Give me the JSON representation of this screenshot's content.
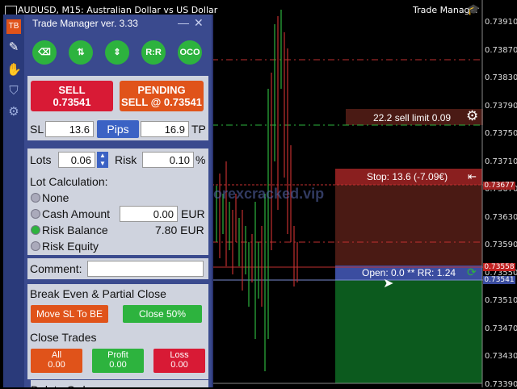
{
  "chart": {
    "symbol_title": "AUDUSD, M15:  Australian Dollar vs US Dollar",
    "trade_manager_label": "Trade Manager",
    "price_axis": [
      "0.73910",
      "0.73870",
      "0.73830",
      "0.73790",
      "0.73750",
      "0.73710",
      "0.73670",
      "0.73630",
      "0.73590",
      "0.73550",
      "0.73510",
      "0.73470",
      "0.73430",
      "0.73390"
    ],
    "sell_limit_label": "22.2 sell limit 0.09",
    "stop_label": "Stop: 13.6 (-7.09€)",
    "open_label": "Open: 0.0 ** RR: 1.24",
    "stop_price_tag": "0.73677",
    "bid_price_tag": "0.73558",
    "open_price_tag": "0.73541",
    "watermark": "forexcracked.vip"
  },
  "panel": {
    "title": "Trade Manager ver. 3.33",
    "toolbar": {
      "rr": "R:R",
      "oco": "OCO"
    },
    "sell_label": "SELL",
    "sell_price": "0.73541",
    "pending_label": "PENDING",
    "pending_price": "SELL @ 0.73541",
    "sl_label": "SL",
    "sl_value": "13.6",
    "pips_label": "Pips",
    "tp_value": "16.9",
    "tp_label": "TP",
    "lots_label": "Lots",
    "lots_value": "0.06",
    "risk_label": "Risk",
    "risk_value": "0.10",
    "percent": "%",
    "lot_calc_label": "Lot Calculation:",
    "none_label": "None",
    "cash_label": "Cash Amount",
    "cash_value": "0.00",
    "cash_unit": "EUR",
    "balance_label": "Risk Balance",
    "balance_value": "7.80 EUR",
    "equity_label": "Risk Equity",
    "comment_label": "Comment:",
    "comment_value": "",
    "be_label": "Break Even & Partial Close",
    "move_sl_btn": "Move SL To BE",
    "close50_btn": "Close 50%",
    "close_trades_label": "Close Trades",
    "all_label": "All",
    "all_value": "0.00",
    "profit_label": "Profit",
    "profit_value": "0.00",
    "loss_label": "Loss",
    "loss_value": "0.00",
    "delete_orders_label": "Delete Orders"
  },
  "colors": {
    "sell": "#d81a35",
    "pending": "#e0531a",
    "green": "#2db33e",
    "panel": "#3a4a8e"
  }
}
